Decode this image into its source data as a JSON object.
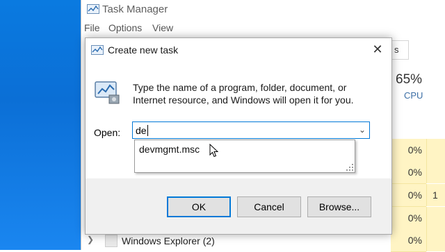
{
  "task_manager": {
    "title": "Task Manager",
    "menu": [
      "File",
      "Options",
      "View"
    ],
    "tab_stub": "s",
    "cpu_header": {
      "percent": "65%",
      "label": "CPU"
    },
    "cpu_cells": [
      "0%",
      "0%",
      "0%",
      "0%",
      "0%"
    ],
    "next_col_cell": "1",
    "process_row": {
      "name": "Windows Explorer (2)"
    }
  },
  "dialog": {
    "title": "Create new task",
    "description": "Type the name of a program, folder, document, or Internet resource, and Windows will open it for you.",
    "open_label": "Open:",
    "open_value": "de",
    "autocomplete": [
      "devmgmt.msc"
    ],
    "buttons": {
      "ok": "OK",
      "cancel": "Cancel",
      "browse": "Browse..."
    }
  },
  "icons": [
    "task-manager-icon",
    "close-icon",
    "run-program-icon",
    "chevron-down-icon",
    "resize-grip-icon",
    "mouse-pointer-icon",
    "expand-chevron-icon"
  ],
  "colors": {
    "accent": "#0078d7",
    "desktop": "#0b6fd6",
    "cpu_highlight": "#fff4c4"
  }
}
